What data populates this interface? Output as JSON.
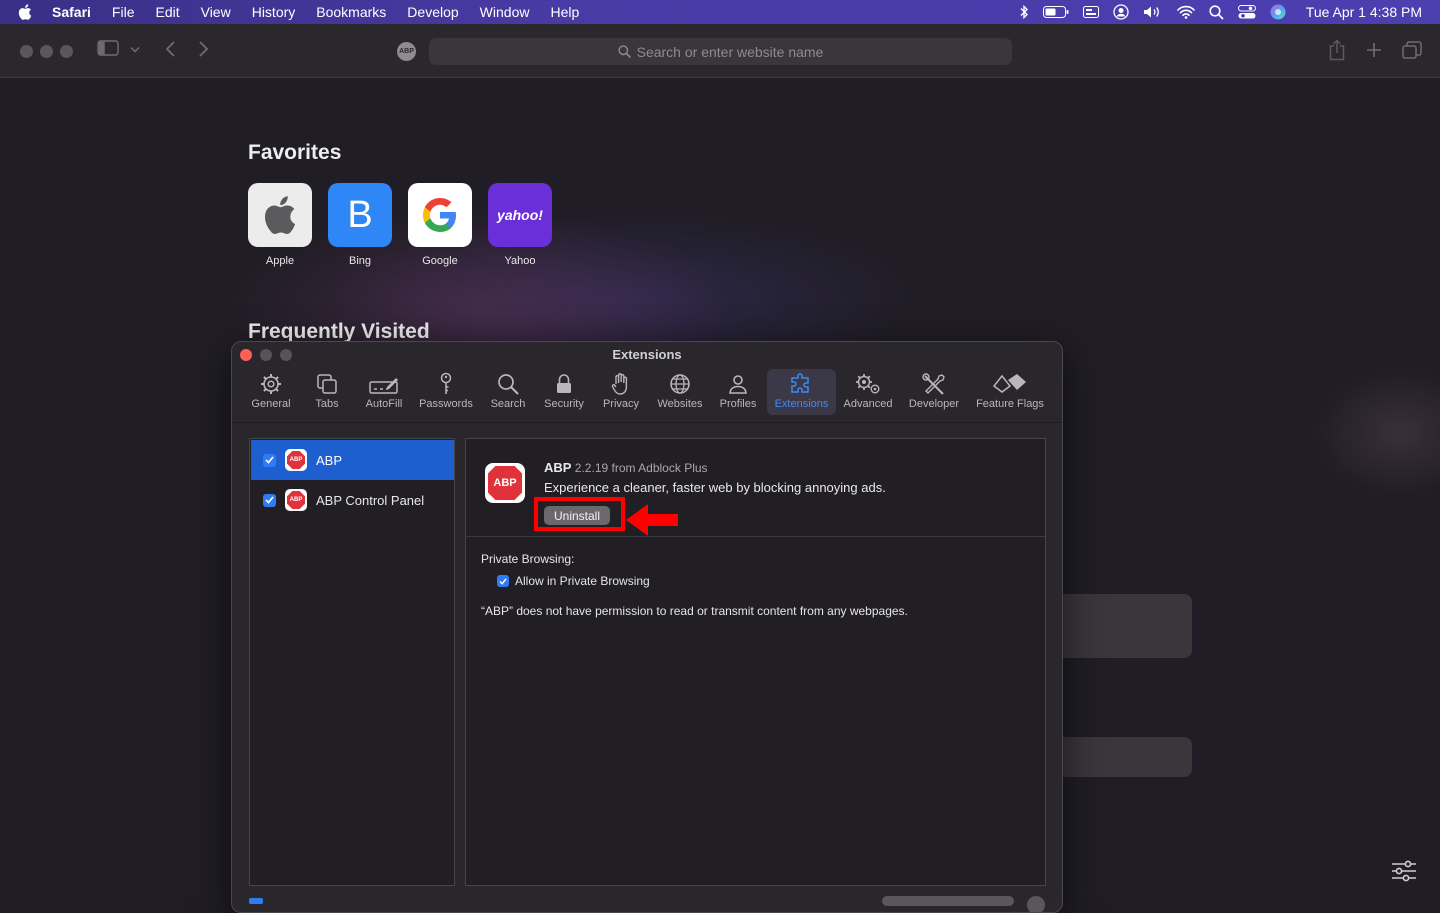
{
  "menubar": {
    "app": "Safari",
    "items": [
      "File",
      "Edit",
      "View",
      "History",
      "Bookmarks",
      "Develop",
      "Window",
      "Help"
    ],
    "clock": "Tue Apr 1  4:38 PM"
  },
  "toolbar": {
    "search_placeholder": "Search or enter website name",
    "extension_badge": "ABP"
  },
  "startpage": {
    "favorites_title": "Favorites",
    "favorites": [
      {
        "label": "Apple"
      },
      {
        "label": "Bing",
        "glyph": "B"
      },
      {
        "label": "Google",
        "glyph": "G"
      },
      {
        "label": "Yahoo",
        "glyph": "yahoo!"
      }
    ],
    "frequently_visited_title": "Frequently Visited"
  },
  "prefs": {
    "title": "Extensions",
    "tabs": [
      "General",
      "Tabs",
      "AutoFill",
      "Passwords",
      "Search",
      "Security",
      "Privacy",
      "Websites",
      "Profiles",
      "Extensions",
      "Advanced",
      "Developer",
      "Feature Flags"
    ],
    "active_tab": "Extensions",
    "extensions": [
      {
        "name": "ABP",
        "enabled": true,
        "selected": true
      },
      {
        "name": "ABP Control Panel",
        "enabled": true,
        "selected": false
      }
    ],
    "detail": {
      "icon_text": "ABP",
      "name": "ABP",
      "version_line": "2.2.19 from Adblock Plus",
      "description": "Experience a cleaner, faster web by blocking annoying ads.",
      "uninstall_label": "Uninstall",
      "private_browsing_label": "Private Browsing:",
      "allow_private_label": "Allow in Private Browsing",
      "permission_note": "“ABP” does not have permission to read or transmit content from any webpages."
    }
  },
  "colors": {
    "accent": "#2f7bf5",
    "highlight_annotation": "#ff0000",
    "abp_red": "#e0323b"
  }
}
